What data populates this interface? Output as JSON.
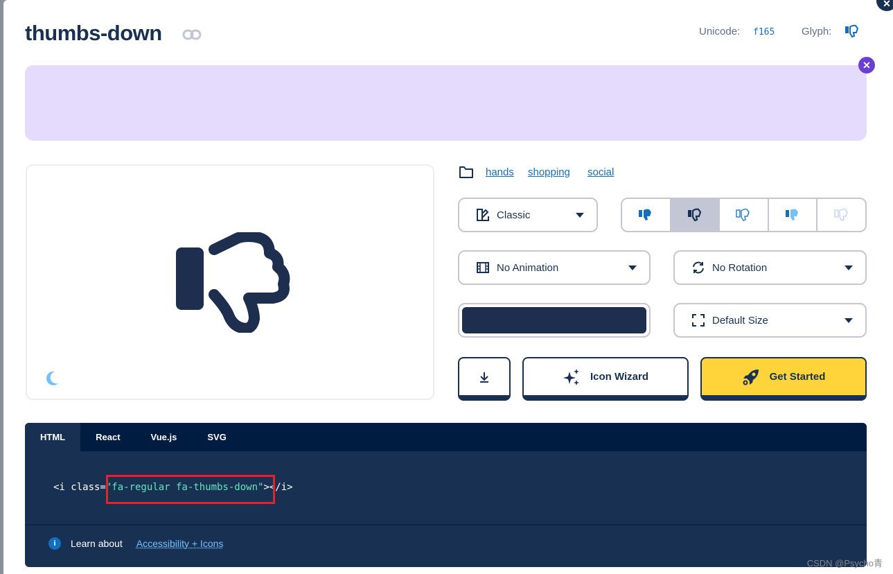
{
  "header": {
    "title": "thumbs-down",
    "unicode_label": "Unicode:",
    "unicode_value": "f165",
    "glyph_label": "Glyph:"
  },
  "banner": {
    "close_icon": "close-icon"
  },
  "tags": [
    "hands",
    "shopping",
    "social"
  ],
  "family_select": {
    "value": "Classic"
  },
  "styles": [
    {
      "name": "solid",
      "selected": false
    },
    {
      "name": "regular",
      "selected": true
    },
    {
      "name": "light",
      "selected": false
    },
    {
      "name": "duotone",
      "selected": false
    },
    {
      "name": "thin",
      "selected": false
    }
  ],
  "animation_select": {
    "value": "No Animation"
  },
  "rotation_select": {
    "value": "No Rotation"
  },
  "size_select": {
    "value": "Default Size"
  },
  "color": {
    "value": "#1e2e4f"
  },
  "buttons": {
    "wizard": "Icon Wizard",
    "start": "Get Started"
  },
  "code": {
    "tabs": [
      "HTML",
      "React",
      "Vue.js",
      "SVG"
    ],
    "active_tab": "HTML",
    "prefix": "<i class=",
    "string": "\"fa-regular fa-thumbs-down\"",
    "suffix": "></i>"
  },
  "footer": {
    "learn": "Learn about",
    "link": "Accessibility + Icons"
  },
  "watermark": "CSDN @Psycho青",
  "colors": {
    "brand": "#183153",
    "accent": "#146ebe",
    "yellow": "#ffd43b",
    "banner": "#e5dcfd"
  }
}
